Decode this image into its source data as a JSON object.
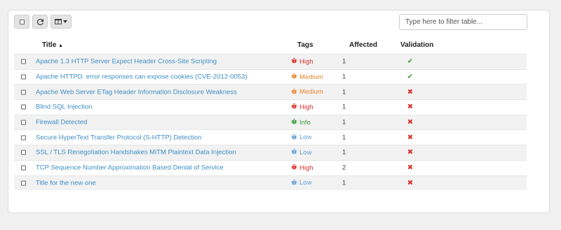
{
  "toolbar": {
    "select_all": "checkbox-icon",
    "refresh": "refresh-icon",
    "columns": "columns-dropdown-icon"
  },
  "filter": {
    "placeholder": "Type here to filter table...",
    "value": ""
  },
  "table": {
    "columns": {
      "title": "Title",
      "sort_indicator": "▲",
      "tags": "Tags",
      "affected": "Affected",
      "validation": "Validation"
    },
    "rows": [
      {
        "title": "Apache 1.3 HTTP Server Expect Header Cross-Site Scripting",
        "tag": "High",
        "affected": "1",
        "validated": true
      },
      {
        "title": "Apache HTTPD: error responses can expose cookies (CVE-2012-0053)",
        "tag": "Medium",
        "affected": "1",
        "validated": true
      },
      {
        "title": "Apache Web Server ETag Header Information Disclosure Weakness",
        "tag": "Medium",
        "affected": "1",
        "validated": false
      },
      {
        "title": "Blind SQL Injection",
        "tag": "High",
        "affected": "1",
        "validated": false
      },
      {
        "title": "Firewall Detected",
        "tag": "Info",
        "affected": "1",
        "validated": false
      },
      {
        "title": "Secure HyperText Transfer Protocol (S-HTTP) Detection",
        "tag": "Low",
        "affected": "1",
        "validated": false
      },
      {
        "title": "SSL / TLS Renegotiation Handshakes MiTM Plaintext Data Injection",
        "tag": "Low",
        "affected": "1",
        "validated": false
      },
      {
        "title": "TCP Sequence Number Approximation Based Denial of Service",
        "tag": "High",
        "affected": "2",
        "validated": false
      },
      {
        "title": "Title for the new one",
        "tag": "Low",
        "affected": "1",
        "validated": false
      }
    ]
  },
  "colors": {
    "link": "#3f8dc4",
    "High": "#d9302c",
    "Medium": "#e8862a",
    "Info": "#3e9b3a",
    "Low": "#63a0d4",
    "validated": "#3e9b3a",
    "not_validated": "#d9302c"
  },
  "icons": {
    "tag": "bug-icon",
    "validated": "check-icon",
    "not_validated": "times-icon"
  }
}
